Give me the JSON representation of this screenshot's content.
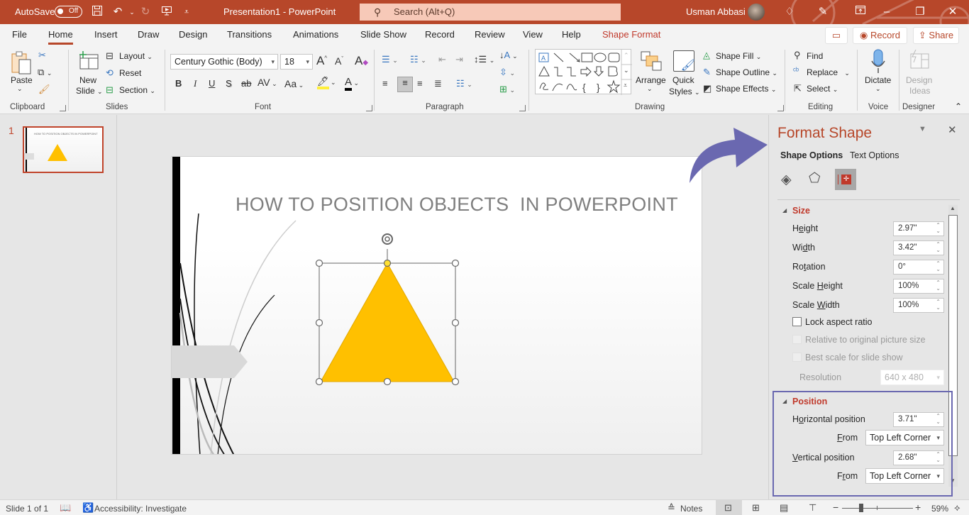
{
  "titlebar": {
    "autosave_label": "AutoSave",
    "autosave_state": "Off",
    "doc_title": "Presentation1  -  PowerPoint",
    "search_placeholder": "Search (Alt+Q)",
    "user_name": "Usman Abbasi",
    "icons": [
      "save-icon",
      "undo-icon",
      "redo-icon",
      "present-icon",
      "customize-icon",
      "diamond-icon",
      "pen-icon",
      "ribbon-display-icon",
      "minimize-icon",
      "restore-icon",
      "close-icon"
    ]
  },
  "tabs": [
    {
      "label": "File"
    },
    {
      "label": "Home",
      "active": true
    },
    {
      "label": "Insert"
    },
    {
      "label": "Draw"
    },
    {
      "label": "Design"
    },
    {
      "label": "Transitions"
    },
    {
      "label": "Animations"
    },
    {
      "label": "Slide Show"
    },
    {
      "label": "Record"
    },
    {
      "label": "Review"
    },
    {
      "label": "View"
    },
    {
      "label": "Help"
    },
    {
      "label": "Shape Format",
      "contextual": true
    }
  ],
  "tab_buttons": {
    "comments": "☐",
    "record": "Record",
    "share": "Share"
  },
  "ribbon": {
    "clipboard": {
      "label": "Clipboard",
      "paste": "Paste"
    },
    "slides": {
      "label": "Slides",
      "new_slide_1": "New",
      "new_slide_2": "Slide",
      "layout": "Layout",
      "reset": "Reset",
      "section": "Section"
    },
    "font": {
      "label": "Font",
      "font_name": "Century Gothic (Body)",
      "font_size": "18",
      "buttons": [
        "B",
        "I",
        "U",
        "S",
        "ab",
        "AV",
        "Aa"
      ]
    },
    "paragraph": {
      "label": "Paragraph"
    },
    "drawing": {
      "label": "Drawing",
      "arrange": "Arrange",
      "quick_styles_1": "Quick",
      "quick_styles_2": "Styles",
      "shape_fill": "Shape Fill",
      "shape_outline": "Shape Outline",
      "shape_effects": "Shape Effects"
    },
    "editing": {
      "label": "Editing",
      "find": "Find",
      "replace": "Replace",
      "select": "Select"
    },
    "voice": {
      "label": "Voice",
      "dictate": "Dictate"
    },
    "designer": {
      "label": "Designer",
      "design_ideas_1": "Design",
      "design_ideas_2": "Ideas"
    }
  },
  "thumbnails": [
    {
      "number": "1",
      "title": "HOW TO POSITION OBJECTS  IN POWERPOINT"
    }
  ],
  "slide": {
    "title": "HOW TO POSITION OBJECTS  IN POWERPOINT",
    "shape": "triangle",
    "shape_color": "#ffc000"
  },
  "format_pane": {
    "title": "Format Shape",
    "tabs": [
      {
        "label": "Shape Options",
        "active": true
      },
      {
        "label": "Text Options"
      }
    ],
    "size": {
      "header": "Size",
      "height_label": "Height",
      "height": "2.97\"",
      "width_label": "Width",
      "width": "3.42\"",
      "rotation_label": "Rotation",
      "rotation": "0°",
      "scale_height_label": "Scale Height",
      "scale_height": "100%",
      "scale_width_label": "Scale Width",
      "scale_width": "100%",
      "lock_aspect": "Lock aspect ratio",
      "lock_aspect_checked": false,
      "relative_original": "Relative to original picture size",
      "best_scale": "Best scale for slide show",
      "resolution_label": "Resolution",
      "resolution": "640 x 480"
    },
    "position": {
      "header": "Position",
      "horizontal_label": "Horizontal position",
      "horizontal": "3.71\"",
      "from_label_1": "From",
      "horizontal_from": "Top Left Corner",
      "vertical_label": "Vertical position",
      "vertical": "2.68\"",
      "from_label_2": "From",
      "vertical_from": "Top Left Corner"
    }
  },
  "statusbar": {
    "slide_info": "Slide 1 of 1",
    "accessibility": "Accessibility: Investigate",
    "notes": "Notes",
    "zoom": "59%"
  },
  "colors": {
    "brand": "#b7472a",
    "accent_highlight": "#6a68b0",
    "shape_fill": "#ffc000"
  }
}
